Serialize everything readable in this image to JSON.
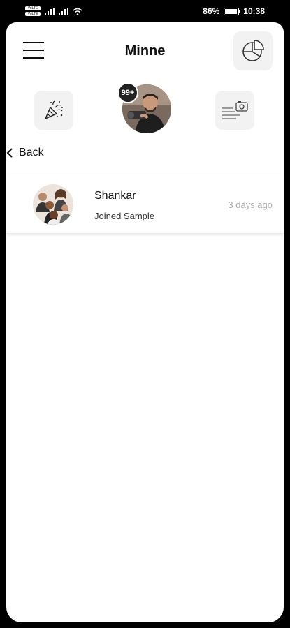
{
  "status_bar": {
    "sim_labels": [
      "VoLTE",
      "VoLTE"
    ],
    "battery": "86%",
    "time": "10:38"
  },
  "header": {
    "title": "Minne",
    "menu_icon": "hamburger-icon",
    "right_icon": "pie-chart-icon"
  },
  "toolbar": {
    "left_icon": "party-popper-icon",
    "right_icon": "news-photo-icon",
    "badge": "99+"
  },
  "nav": {
    "back_label": "Back"
  },
  "notifications": [
    {
      "name": "Shankar",
      "message": "Joined Sample",
      "time": "3 days ago"
    }
  ]
}
